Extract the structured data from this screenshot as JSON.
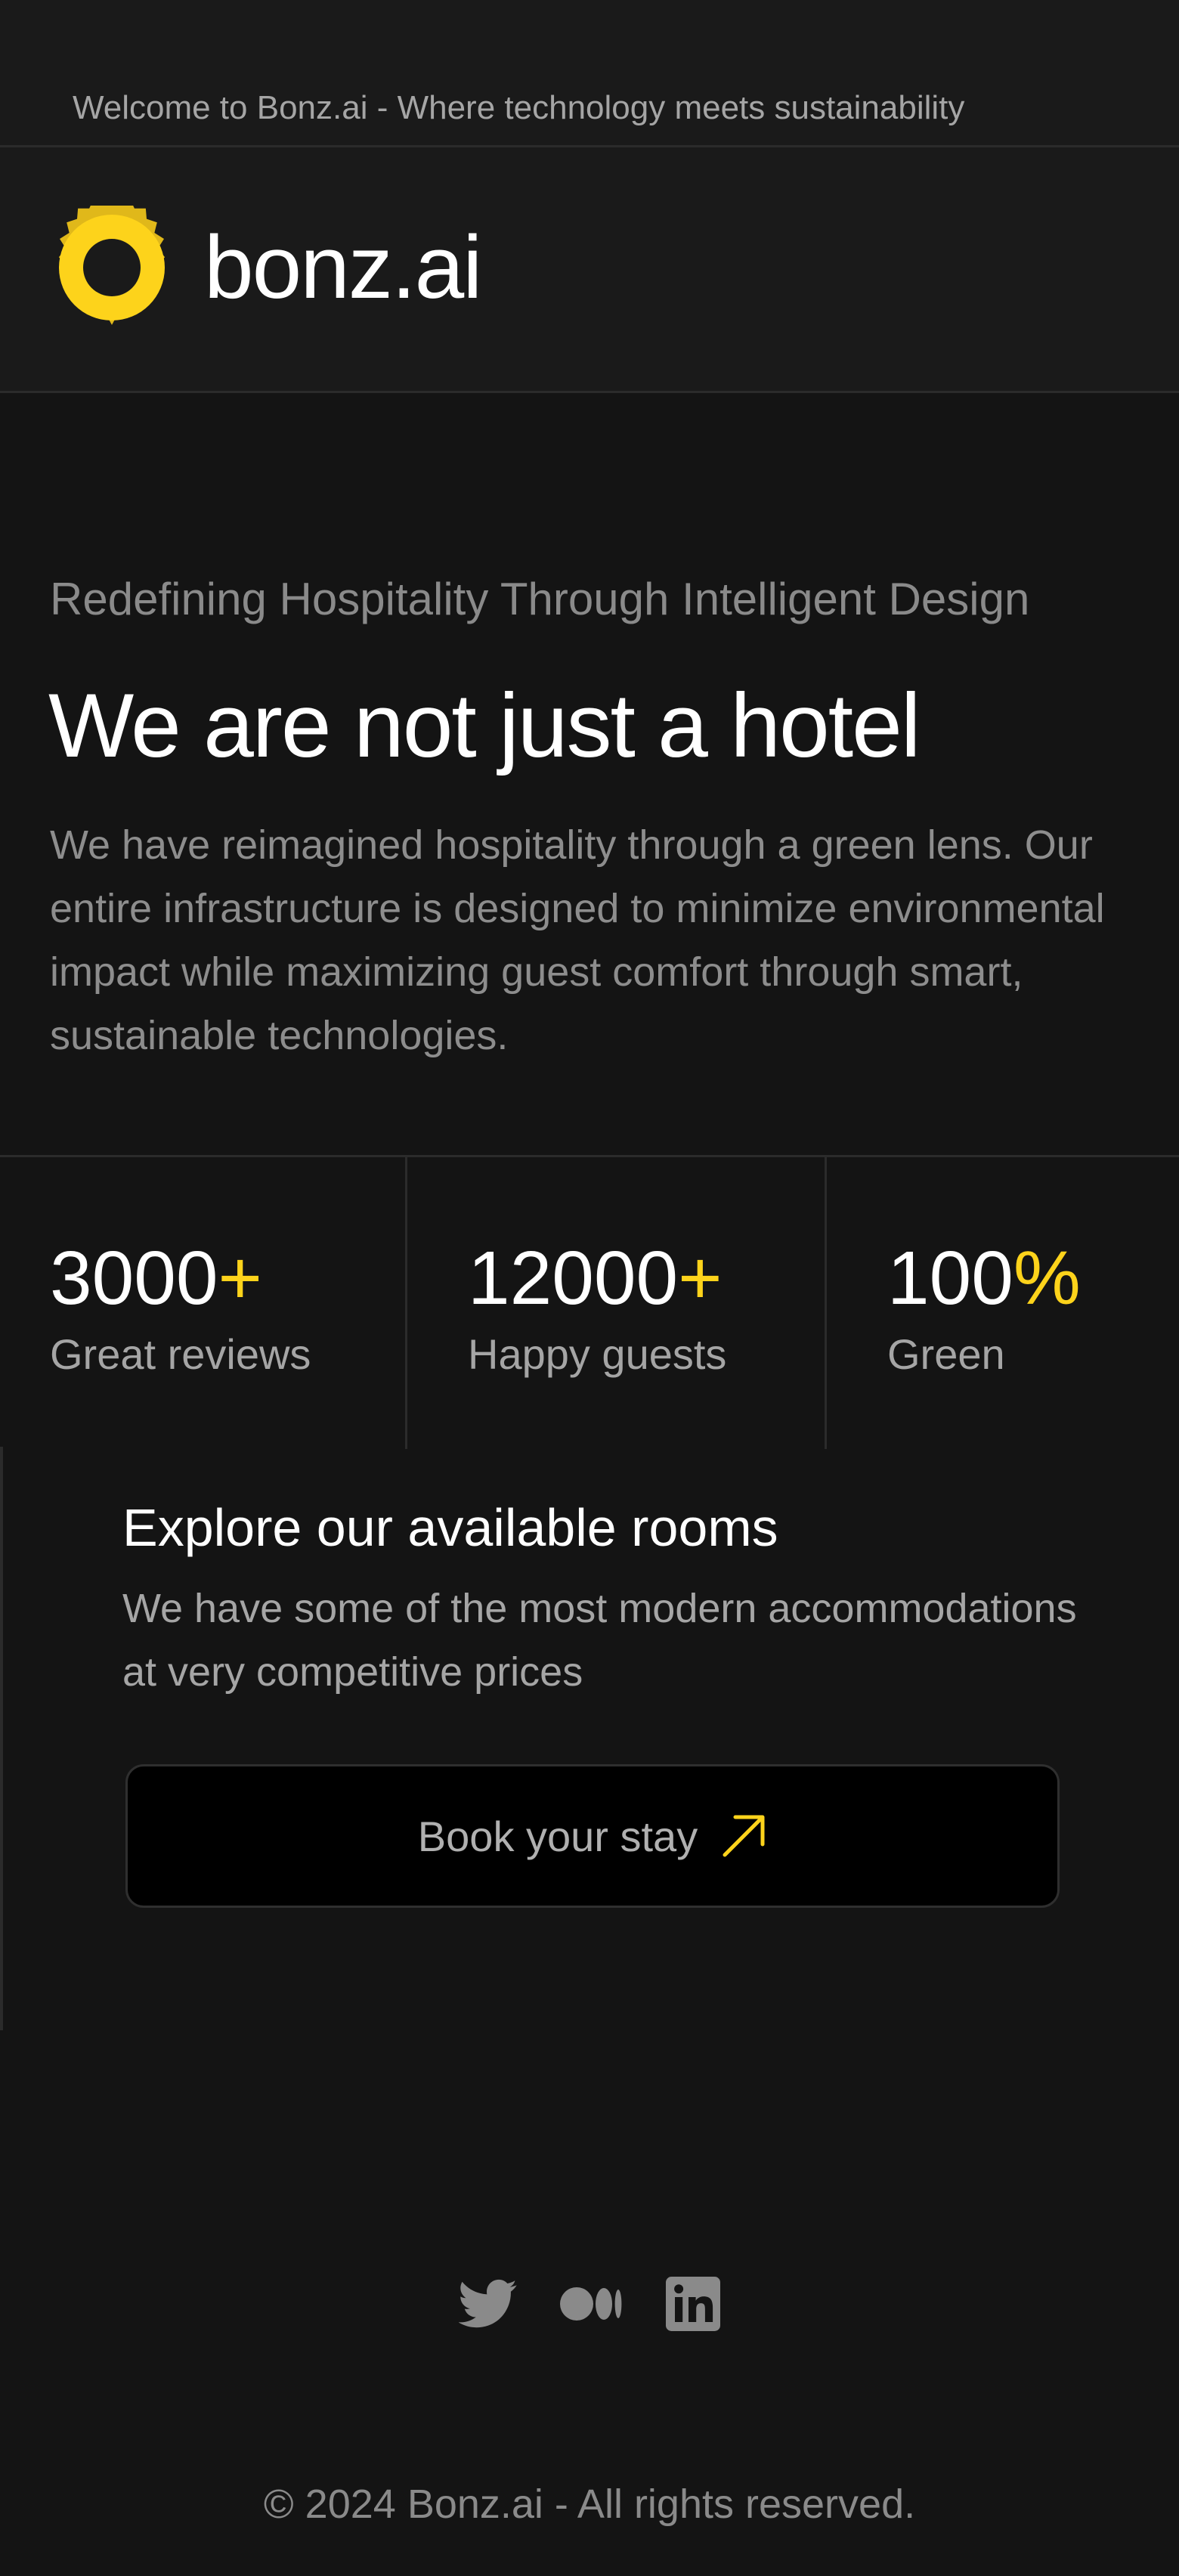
{
  "topbar": {
    "welcome_text": "Welcome to Bonz.ai - Where technology meets sustainability"
  },
  "header": {
    "brand_name": "bonz.ai",
    "logo_color": "#fdd31b"
  },
  "hero": {
    "eyebrow": "Redefining Hospitality Through Intelligent Design",
    "title": "We are not just a hotel",
    "body": "We have reimagined hospitality through a green lens. Our entire infrastructure is designed to minimize environmental impact while maximizing guest comfort through smart, sustainable technologies."
  },
  "stats": [
    {
      "value": "3000",
      "suffix": "+",
      "label": "Great reviews"
    },
    {
      "value": "12000",
      "suffix": "+",
      "label": "Happy guests"
    },
    {
      "value": "100",
      "suffix": "%",
      "label": "Green"
    }
  ],
  "rooms": {
    "title": "Explore our available rooms",
    "body": "We have some of the most modern accommodations at very competitive prices",
    "cta_label": "Book your stay",
    "cta_icon": "arrow-up-right-icon"
  },
  "social": {
    "icons": [
      "twitter-icon",
      "medium-icon",
      "linkedin-icon"
    ]
  },
  "footer": {
    "copyright": "© 2024 Bonz.ai - All rights reserved."
  },
  "colors": {
    "background": "#141414",
    "surface": "#1a1a1a",
    "accent": "#fdd31b",
    "muted_text": "#8d8d8d"
  }
}
